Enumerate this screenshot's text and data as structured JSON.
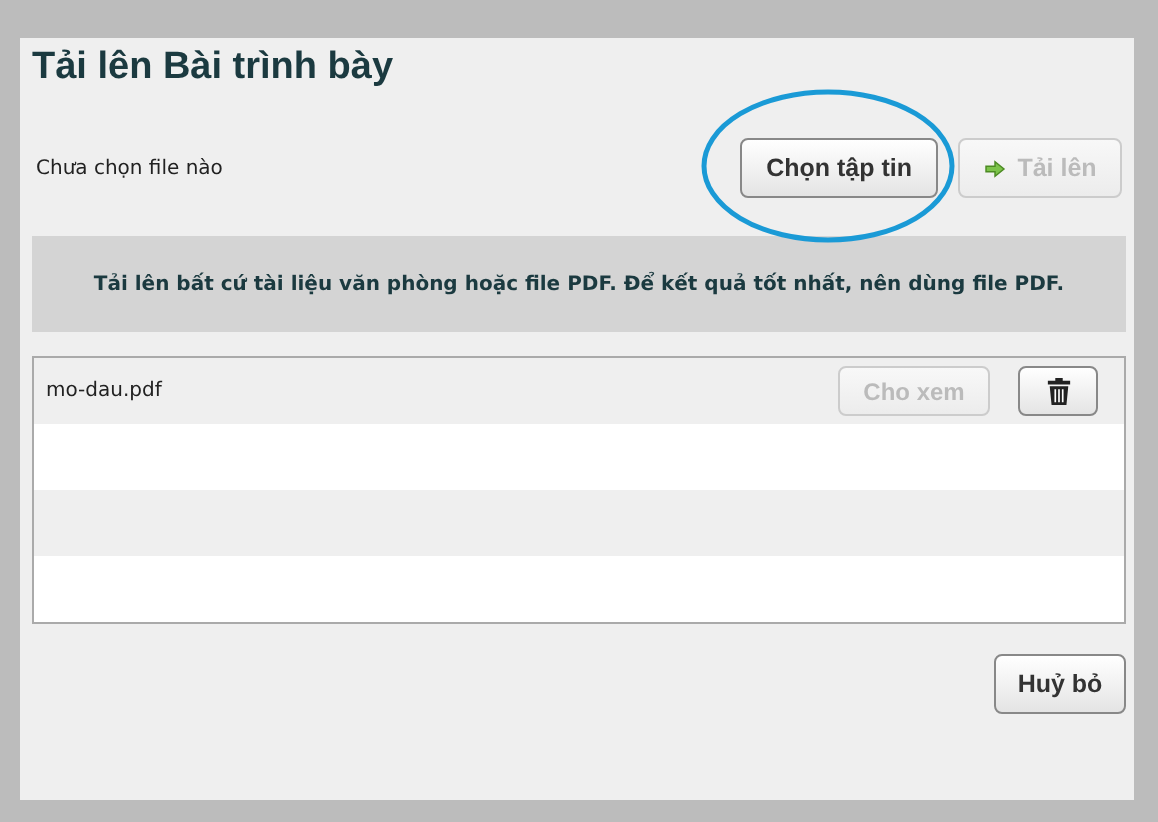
{
  "dialog": {
    "title": "Tải lên Bài trình bày"
  },
  "file_picker": {
    "status": "Chưa chọn file nào",
    "choose_button": {
      "label": "Chọn tập tin",
      "highlighted": true
    },
    "upload_button": {
      "label": "Tải lên",
      "disabled": true
    }
  },
  "info_banner": "Tải lên bất cứ tài liệu văn phòng hoặc file PDF. Để kết quả tốt nhất, nên dùng file PDF.",
  "files": [
    {
      "name": "mo-dau.pdf",
      "preview_button": {
        "label": "Cho xem",
        "disabled": true
      }
    }
  ],
  "buttons": [
    {
      "label": "Huỷ bỏ"
    }
  ]
}
